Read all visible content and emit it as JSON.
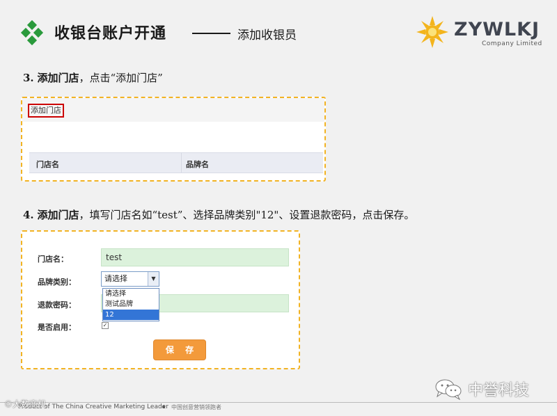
{
  "header": {
    "title_main": "收银台账户开通",
    "title_sub": "添加收银员",
    "brand_name": "ZYWLKJ",
    "brand_sub": "Company Limited",
    "accent_color": "#2a9a3c"
  },
  "step3": {
    "number": "3.",
    "action": "添加门店",
    "instruction": "，点击“添加门店”",
    "add_store_button": "添加门店",
    "columns": [
      "门店名",
      "品牌名"
    ]
  },
  "step4": {
    "number": "4.",
    "action": "添加门店",
    "instruction": "，填写门店名如“test”、选择品牌类别\"12\"、设置退款密码，点击保存。",
    "form": {
      "store_name_label": "门店名：",
      "store_name_value": "test",
      "brand_label": "品牌类别：",
      "brand_selected": "请选择",
      "brand_options": [
        "请选择",
        "测试品牌",
        "12"
      ],
      "refund_password_label": "退款密码：",
      "enabled_label": "是否启用：",
      "enabled_checked": true,
      "save_button": "保 存"
    }
  },
  "footer": {
    "tagline": "Product of The China Creative Marketing Leader",
    "tagline_cn": "中国创意营销领跑者",
    "watermark_left": "©大数商机",
    "watermark_right": "中誉科技"
  },
  "icons": {
    "logo": "sun-logo-icon",
    "wechat": "wechat-icon",
    "dropdown": "chevron-down-icon",
    "checkbox": "check-icon"
  }
}
